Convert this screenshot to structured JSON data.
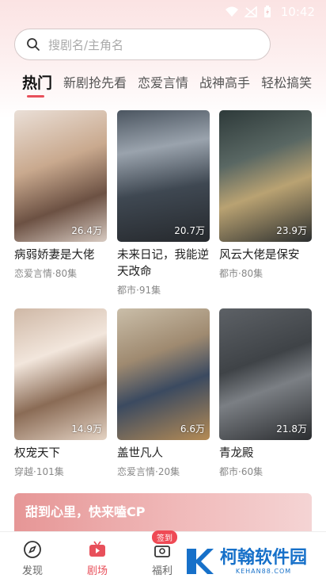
{
  "status_bar": {
    "time": "10:42"
  },
  "search": {
    "placeholder": "搜剧名/主角名"
  },
  "tabs": [
    {
      "label": "热门",
      "active": true
    },
    {
      "label": "新剧抢先看",
      "active": false
    },
    {
      "label": "恋爱言情",
      "active": false
    },
    {
      "label": "战神高手",
      "active": false
    },
    {
      "label": "轻松搞笑",
      "active": false
    }
  ],
  "dramas": [
    {
      "title": "病弱娇妻是大佬",
      "meta": "恋爱言情·80集",
      "views": "26.4万"
    },
    {
      "title": "未来日记，我能逆天改命",
      "meta": "都市·91集",
      "views": "20.7万"
    },
    {
      "title": "风云大佬是保安",
      "meta": "都市·80集",
      "views": "23.9万"
    },
    {
      "title": "权宠天下",
      "meta": "穿越·101集",
      "views": "14.9万"
    },
    {
      "title": "盖世凡人",
      "meta": "恋爱言情·20集",
      "views": "6.6万"
    },
    {
      "title": "青龙殿",
      "meta": "都市·60集",
      "views": "21.8万"
    }
  ],
  "banner": {
    "text": "甜到心里，快来嗑CP"
  },
  "bottom_nav": [
    {
      "label": "发现",
      "icon": "compass-icon",
      "active": false
    },
    {
      "label": "剧场",
      "icon": "tv-icon",
      "active": true
    },
    {
      "label": "福利",
      "icon": "gift-icon",
      "active": false,
      "badge": "签到"
    }
  ],
  "watermark": {
    "text": "柯翰软件园",
    "sub": "KEHAN88.COM"
  },
  "colors": {
    "accent": "#e8505b",
    "header_bg": "#fbe3e3"
  }
}
